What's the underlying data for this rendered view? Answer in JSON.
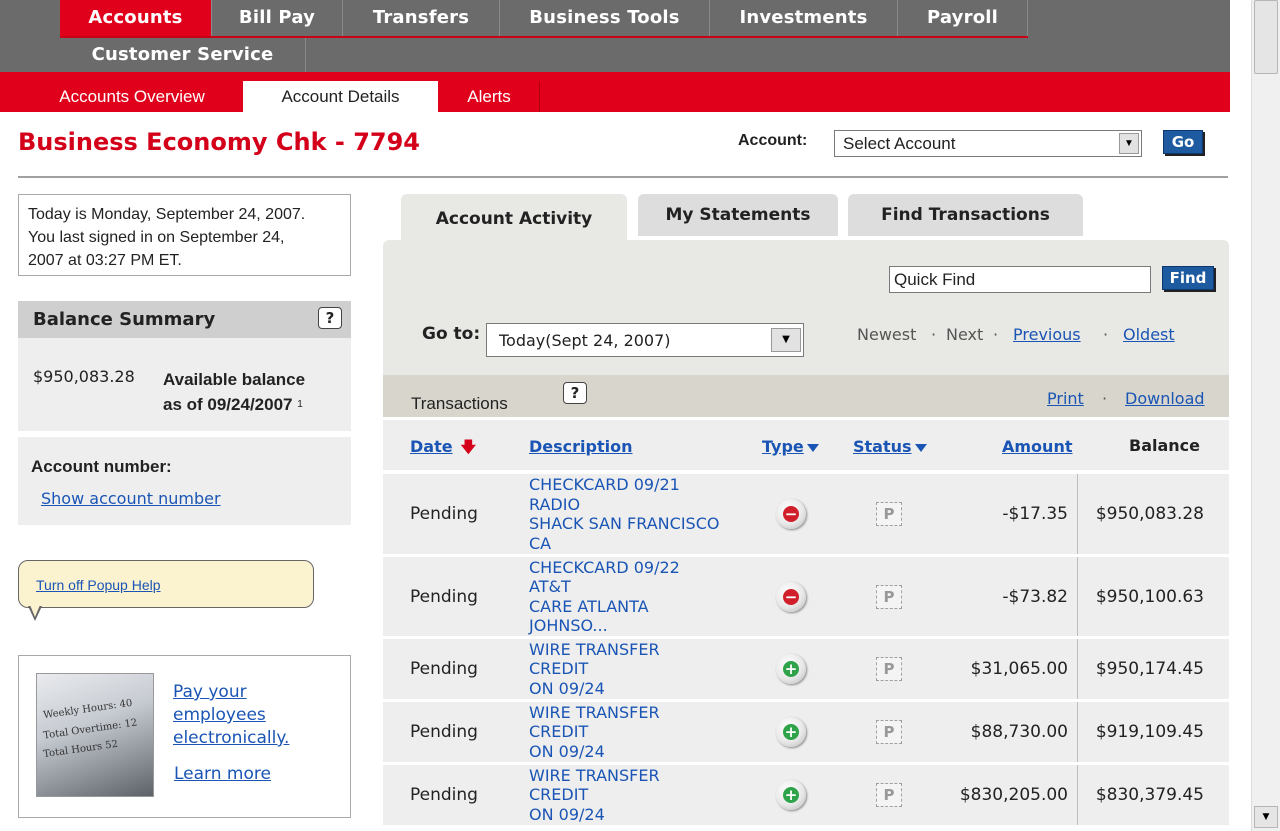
{
  "top_nav": {
    "items": [
      "Accounts",
      "Bill Pay",
      "Transfers",
      "Business Tools",
      "Investments",
      "Payroll",
      "Customer Service"
    ],
    "active": "Accounts"
  },
  "sub_nav": {
    "items": [
      "Accounts Overview",
      "Account Details",
      "Alerts"
    ],
    "active": "Account Details"
  },
  "header": {
    "title": "Business Economy Chk - 7794",
    "account_label": "Account:",
    "account_select_value": "Select Account",
    "go_label": "Go"
  },
  "info_box": {
    "text_line1": "Today is Monday, September 24, 2007.",
    "text_line2": "You last signed in on September 24,",
    "text_line3": "2007 at 03:27 PM ET."
  },
  "balance_summary": {
    "title": "Balance Summary",
    "help": "?",
    "amount": "$950,083.28",
    "label_line1": "Available balance",
    "label_line2": "as of 09/24/2007",
    "footnote": "1"
  },
  "account_number": {
    "label": "Account number:",
    "link": "Show account number"
  },
  "popup_help": {
    "link": "Turn off Popup Help"
  },
  "promo": {
    "image_lines": [
      "Weekly Hours: 40",
      "Total Overtime: 12",
      "Total Hours 52"
    ],
    "link1": "Pay your employees electronically.",
    "link2": "Learn more"
  },
  "tabs": [
    "Account Activity",
    "My Statements",
    "Find Transactions"
  ],
  "active_tab": "Account Activity",
  "activity": {
    "quick_find_value": "Quick Find",
    "find_label": "Find",
    "goto_label": "Go to:",
    "goto_value": "Today(Sept 24, 2007)",
    "nav_newest": "Newest",
    "nav_next": "Next",
    "nav_previous": "Previous",
    "nav_oldest": "Oldest",
    "nav_sep": "·"
  },
  "transactions": {
    "title": "Transactions",
    "help": "?",
    "print": "Print",
    "download": "Download",
    "sep": "·",
    "columns": {
      "date": "Date",
      "description": "Description",
      "type": "Type",
      "status": "Status",
      "amount": "Amount",
      "balance": "Balance"
    },
    "rows": [
      {
        "date": "Pending",
        "description": "CHECKCARD 09/21\nRADIO\nSHACK SAN FRANCISCO\nCA",
        "type": "debit",
        "type_icon": "minus-icon",
        "type_symbol": "−",
        "status": "P",
        "amount": "-$17.35",
        "balance": "$950,083.28"
      },
      {
        "date": "Pending",
        "description": "CHECKCARD 09/22\nAT&T\nCARE ATLANTA\nJOHNSO...",
        "type": "debit",
        "type_icon": "minus-icon",
        "type_symbol": "−",
        "status": "P",
        "amount": "-$73.82",
        "balance": "$950,100.63"
      },
      {
        "date": "Pending",
        "description": "WIRE TRANSFER\nCREDIT\nON 09/24",
        "type": "credit",
        "type_icon": "plus-icon",
        "type_symbol": "+",
        "status": "P",
        "amount": "$31,065.00",
        "balance": "$950,174.45"
      },
      {
        "date": "Pending",
        "description": "WIRE TRANSFER\nCREDIT\nON 09/24",
        "type": "credit",
        "type_icon": "plus-icon",
        "type_symbol": "+",
        "status": "P",
        "amount": "$88,730.00",
        "balance": "$919,109.45"
      },
      {
        "date": "Pending",
        "description": "WIRE TRANSFER\nCREDIT\nON 09/24",
        "type": "credit",
        "type_icon": "plus-icon",
        "type_symbol": "+",
        "status": "P",
        "amount": "$830,205.00",
        "balance": "$830,379.45"
      }
    ]
  },
  "colors": {
    "brand_red": "#e0001b",
    "nav_gray": "#6b6b6b",
    "link_blue": "#1a55b5",
    "button_blue": "#1d5aa0",
    "credit_green": "#2fa34a",
    "debit_red": "#d01f2a"
  }
}
